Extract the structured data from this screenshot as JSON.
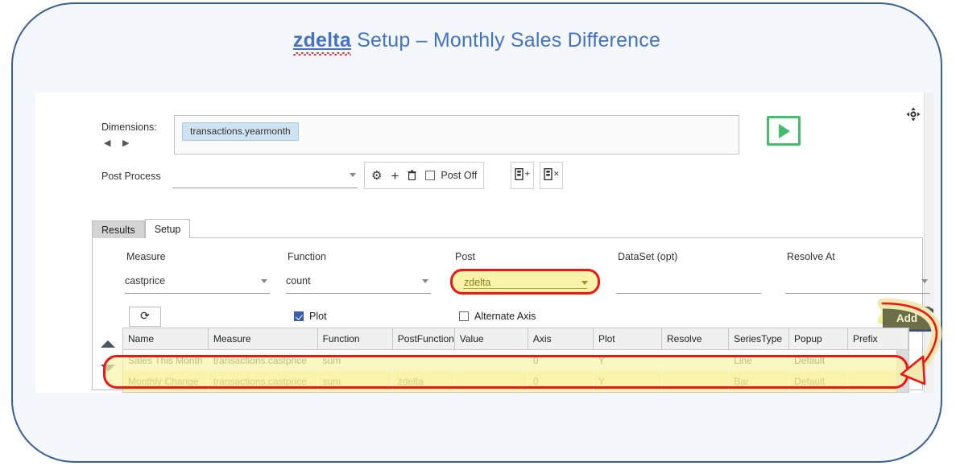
{
  "title": {
    "keyword": "zdelta",
    "rest": " Setup – Monthly Sales Difference"
  },
  "window": {
    "move_handle_icon": "move-crosshair-icon"
  },
  "dimensions": {
    "label": "Dimensions:",
    "prev_icon": "◀",
    "next_icon": "▶",
    "chip": "transactions.yearmonth",
    "run_button_icon": "play-icon"
  },
  "post_process": {
    "label": "Post Process",
    "value": "",
    "toolbar": {
      "gear_icon": "⚙",
      "add_icon": "+",
      "delete_icon": "🗑",
      "post_off_label": "Post Off",
      "post_off_checked": false
    },
    "panel_add_icon": "▤+",
    "panel_delete_icon": "▤×"
  },
  "tabs": [
    {
      "label": "Results",
      "active": false
    },
    {
      "label": "Setup",
      "active": true
    }
  ],
  "setup": {
    "columns": {
      "measure": "Measure",
      "function": "Function",
      "post": "Post",
      "dataset": "DataSet (opt)",
      "resolve_at": "Resolve At"
    },
    "values": {
      "measure": "castprice",
      "function": "count",
      "post": "zdelta",
      "dataset": "",
      "resolve_at": ""
    },
    "refresh_icon": "⟳",
    "plot_label": "Plot",
    "plot_checked": true,
    "alternate_axis_label": "Alternate Axis",
    "alternate_axis_checked": false,
    "add_button_label": "Add"
  },
  "grid": {
    "headers": [
      "Name",
      "Measure",
      "Function",
      "PostFunction",
      "Value",
      "Axis",
      "Plot",
      "Resolve",
      "SeriesType",
      "Popup",
      "Prefix"
    ],
    "rows": [
      {
        "highlighted": false,
        "cells": [
          "Sales This Month",
          "transactions.castprice",
          "sum",
          "",
          "",
          "0",
          "Y",
          "",
          "Line",
          "Default",
          ""
        ]
      },
      {
        "highlighted": true,
        "cells": [
          "Monthly Change",
          "transactions.castprice",
          "sum",
          "zdelta",
          "",
          "0",
          "Y",
          "",
          "Bar",
          "Default",
          ""
        ]
      }
    ],
    "sort_up_icon": "▲",
    "sort_down_icon": "▼"
  },
  "colors": {
    "card_border": "#3a5e96",
    "card_fill": "#f4f8fc",
    "title_blue": "#4472c4",
    "highlight_red": "#f01414",
    "highlight_yellow": "#faf4ab",
    "run_green": "#45be6b",
    "chip_blue": "#cfe3f2",
    "add_button": "#6a6f4a",
    "checkbox_blue": "#3b5bb5"
  }
}
